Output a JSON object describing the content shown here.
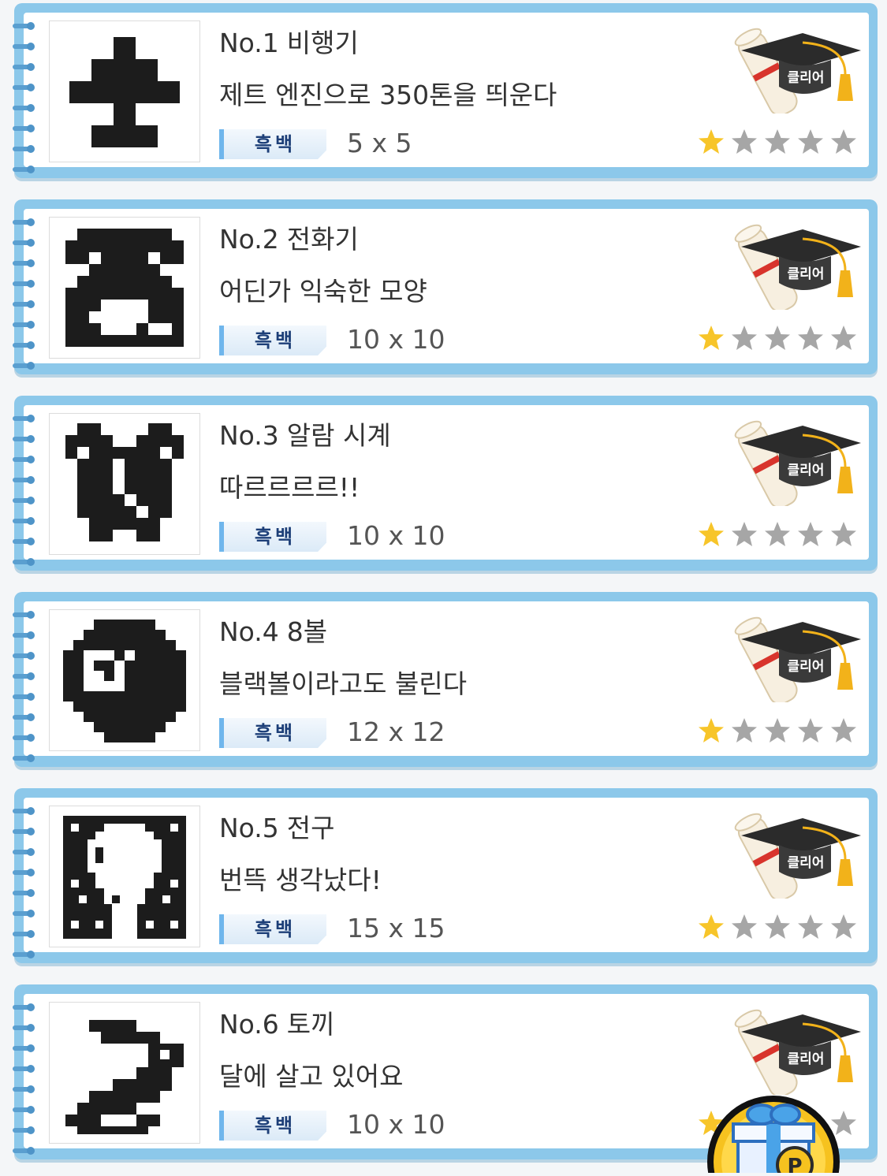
{
  "colors": {
    "card_frame": "#8cc8ea",
    "ring": "#5a9fd0",
    "tag_text": "#1d3f78",
    "star_filled": "#f7c52a",
    "star_empty": "#a6a6a6",
    "cap": "#2b2b2b",
    "tassel": "#f2b21a"
  },
  "puzzles": [
    {
      "number": "No.1",
      "name": "비행기",
      "description": "제트 엔진으로 350톤을 띄운다",
      "tag": "흑백",
      "size": "5 x 5",
      "badge": "클리어",
      "rating": 1,
      "max_rating": 5,
      "icon": "airplane-pixel-icon"
    },
    {
      "number": "No.2",
      "name": "전화기",
      "description": "어딘가 익숙한 모양",
      "tag": "흑백",
      "size": "10 x 10",
      "badge": "클리어",
      "rating": 1,
      "max_rating": 5,
      "icon": "telephone-pixel-icon"
    },
    {
      "number": "No.3",
      "name": "알람 시계",
      "description": "따르르르르!!",
      "tag": "흑백",
      "size": "10 x 10",
      "badge": "클리어",
      "rating": 1,
      "max_rating": 5,
      "icon": "alarm-clock-pixel-icon"
    },
    {
      "number": "No.4",
      "name": "8볼",
      "description": "블랙볼이라고도 불린다",
      "tag": "흑백",
      "size": "12 x 12",
      "badge": "클리어",
      "rating": 1,
      "max_rating": 5,
      "icon": "eight-ball-pixel-icon"
    },
    {
      "number": "No.5",
      "name": "전구",
      "description": "번뜩 생각났다!",
      "tag": "흑백",
      "size": "15 x 15",
      "badge": "클리어",
      "rating": 1,
      "max_rating": 5,
      "icon": "light-bulb-pixel-icon"
    },
    {
      "number": "No.6",
      "name": "토끼",
      "description": "달에 살고 있어요",
      "tag": "흑백",
      "size": "10 x 10",
      "badge": "클리어",
      "rating": 1,
      "max_rating": 5,
      "icon": "rabbit-pixel-icon"
    }
  ],
  "gift_button": {
    "icon": "gift-icon",
    "coin_label": "P"
  }
}
